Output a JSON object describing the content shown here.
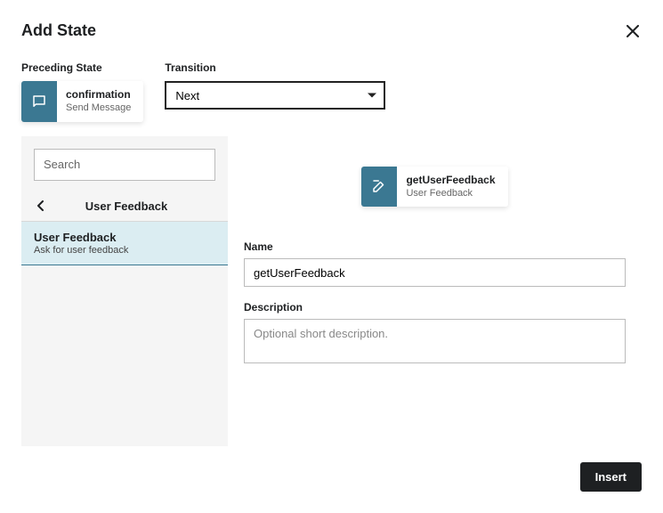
{
  "header": {
    "title": "Add State"
  },
  "preceding": {
    "label": "Preceding State",
    "chip": {
      "title": "confirmation",
      "subtitle": "Send Message"
    }
  },
  "transition": {
    "label": "Transition",
    "value": "Next"
  },
  "sidebar": {
    "search_placeholder": "Search",
    "category_title": "User Feedback",
    "items": [
      {
        "title": "User Feedback",
        "subtitle": "Ask for user feedback"
      }
    ]
  },
  "preview": {
    "chip": {
      "title": "getUserFeedback",
      "subtitle": "User Feedback"
    }
  },
  "form": {
    "name_label": "Name",
    "name_value": "getUserFeedback",
    "description_label": "Description",
    "description_placeholder": "Optional short description."
  },
  "footer": {
    "insert_label": "Insert"
  }
}
